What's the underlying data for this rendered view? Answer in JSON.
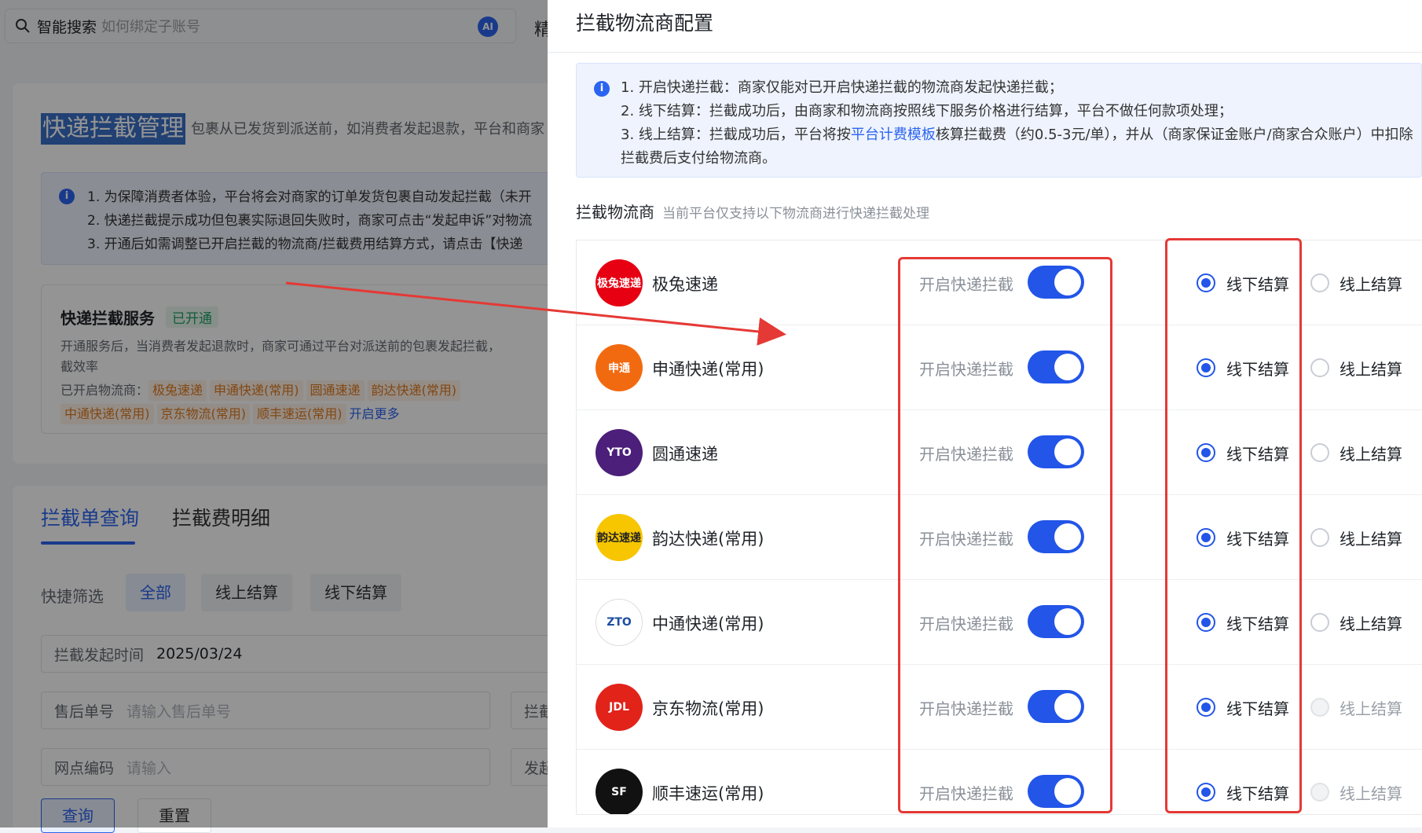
{
  "search": {
    "label": "智能搜索",
    "placeholder": "如何绑定子账号",
    "ai_badge": "AI"
  },
  "topbar_fragment": "精",
  "page": {
    "title": "快递拦截管理",
    "subtitle": "包裹从已发货到派送前，如消费者发起退款，平台和商家",
    "info": [
      "1. 为保障消费者体验，平台将会对商家的订单发货包裹自动发起拦截（未开",
      "2. 快递拦截提示成功但包裹实际退回失败时，商家可点击“发起申诉”对物流",
      "3. 开通后如需调整已开启拦截的物流商/拦截费用结算方式，请点击【快递"
    ]
  },
  "service": {
    "title": "快递拦截服务",
    "status": "已开通",
    "desc_line1": "开通服务后，当消费者发起退款时，商家可通过平台对派送前的包裹发起拦截，",
    "desc_line2": "截效率",
    "enabled_label": "已开启物流商：",
    "tags_row1": [
      "极兔速递",
      "申通快递(常用)",
      "圆通速递",
      "韵达快递(常用)"
    ],
    "tags_row2": [
      "中通快递(常用)",
      "京东物流(常用)",
      "顺丰速运(常用)"
    ],
    "more_link": "开启更多"
  },
  "tabs": [
    "拦截单查询",
    "拦截费明细"
  ],
  "filter": {
    "label": "快捷筛选",
    "chips": [
      "全部",
      "线上结算",
      "线下结算"
    ]
  },
  "form": {
    "time_label": "拦截发起时间",
    "time_value": "2025/03/24",
    "time_sep": "-",
    "aftersale_label": "售后单号",
    "aftersale_placeholder": "请输入售后单号",
    "intercept_label": "拦截",
    "outlet_label": "网点编码",
    "outlet_placeholder": "请输入",
    "initiate_label": "发起",
    "query_button": "查询",
    "reset_button": "重置"
  },
  "drawer": {
    "title": "拦截物流商配置",
    "info": {
      "line1": "1. 开启快递拦截：商家仅能对已开启快递拦截的物流商发起快递拦截；",
      "line2": "2. 线下结算：拦截成功后，由商家和物流商按照线下服务价格进行结算，平台不做任何款项处理；",
      "line3_a": "3. 线上结算：拦截成功后，平台将按",
      "line3_link": "平台计费模板",
      "line3_b": "核算拦截费（约0.5-3元/单），并从（商家保证金账户/商家合众账户）中扣除",
      "line4": "拦截费后支付给物流商。"
    },
    "section_title": "拦截物流商",
    "section_hint": "当前平台仅支持以下物流商进行快递拦截处理",
    "toggle_label": "开启快递拦截",
    "offline_label": "线下结算",
    "online_label": "线上结算",
    "carriers": [
      {
        "name": "极兔速递",
        "logo_text": "极兔速递",
        "logo_color": "#e60012",
        "enabled": true,
        "settlement": "offline",
        "online_disabled": false
      },
      {
        "name": "申通快递(常用)",
        "logo_text": "申通",
        "logo_color": "#f26a10",
        "enabled": true,
        "settlement": "offline",
        "online_disabled": false
      },
      {
        "name": "圆通速递",
        "logo_text": "YTO",
        "logo_color": "#4b1f7a",
        "enabled": true,
        "settlement": "offline",
        "online_disabled": false
      },
      {
        "name": "韵达快递(常用)",
        "logo_text": "韵达速递",
        "logo_color": "#f7c600",
        "enabled": true,
        "settlement": "offline",
        "online_disabled": false
      },
      {
        "name": "中通快递(常用)",
        "logo_text": "ZTO",
        "logo_color": "#ffffff",
        "enabled": true,
        "settlement": "offline",
        "online_disabled": false
      },
      {
        "name": "京东物流(常用)",
        "logo_text": "JDL",
        "logo_color": "#e2231a",
        "enabled": true,
        "settlement": "offline",
        "online_disabled": true
      },
      {
        "name": "顺丰速运(常用)",
        "logo_text": "SF",
        "logo_color": "#111111",
        "enabled": true,
        "settlement": "offline",
        "online_disabled": true
      }
    ]
  }
}
